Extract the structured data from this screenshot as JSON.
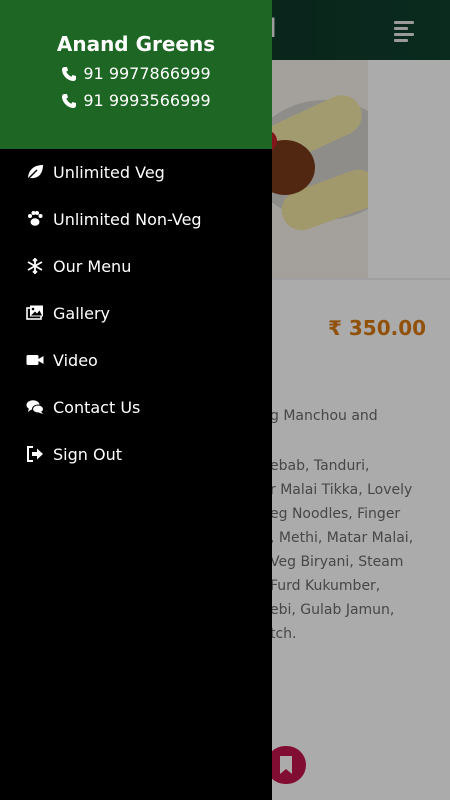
{
  "app": {
    "title_fragment": "d"
  },
  "background": {
    "price": "₹ 350.00",
    "description_lines": [
      "g Manchou and",
      "",
      "ebab, Tanduri,",
      "r Malai Tikka, Lovely",
      "eg Noodles, Finger",
      ", Methi, Matar Malai,",
      "Veg Biryani, Steam",
      "Furd Kukumber,",
      "ebi, Gulab Jamun,",
      "tch."
    ]
  },
  "drawer": {
    "business_name": "Anand Greens",
    "phones": [
      "91 9977866999",
      "91 9993566999"
    ],
    "menu_items": [
      {
        "label": "Unlimited Veg",
        "icon": "leaf-icon"
      },
      {
        "label": "Unlimited Non-Veg",
        "icon": "paw-icon"
      },
      {
        "label": "Our Menu",
        "icon": "snowflake-icon"
      },
      {
        "label": "Gallery",
        "icon": "images-icon"
      },
      {
        "label": "Video",
        "icon": "video-icon"
      },
      {
        "label": "Contact Us",
        "icon": "comments-icon"
      },
      {
        "label": "Sign Out",
        "icon": "sign-out-icon"
      }
    ]
  },
  "colors": {
    "drawer_header": "#1e6623",
    "drawer_bg": "#000000",
    "price": "#d97a10",
    "fab": "#c1154b"
  }
}
